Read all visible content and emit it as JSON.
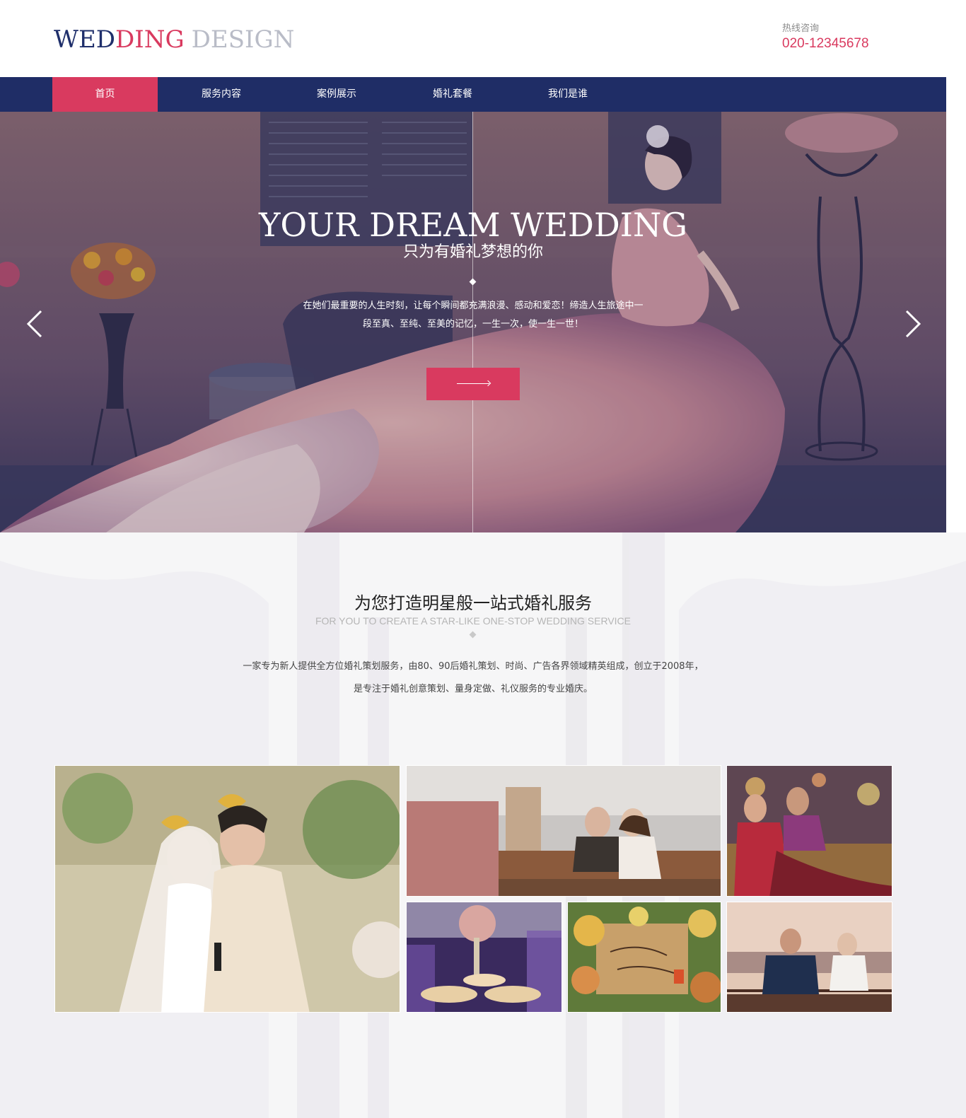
{
  "header": {
    "logo": {
      "part1": "WED",
      "part2": "DING",
      "part3": "DESIGN"
    },
    "hotline_label": "热线咨询",
    "hotline_phone": "020-12345678"
  },
  "nav": {
    "items": [
      {
        "label": "首页",
        "active": true
      },
      {
        "label": "服务内容",
        "active": false
      },
      {
        "label": "案例展示",
        "active": false
      },
      {
        "label": "婚礼套餐",
        "active": false
      },
      {
        "label": "我们是谁",
        "active": false
      }
    ]
  },
  "hero": {
    "title": "YOUR DREAM WEDDING",
    "subtitle": "只为有婚礼梦想的你",
    "desc_line1": "在她们最重要的人生时刻，让每个瞬间都充满浪漫、感动和爱恋！缔造人生旅途中一",
    "desc_line2": "段至真、至纯、至美的记忆，一生一次，使一生一世！",
    "button_icon": "arrow-right-icon",
    "prev_icon": "chevron-left-icon",
    "next_icon": "chevron-right-icon"
  },
  "services": {
    "title": "为您打造明星般一站式婚礼服务",
    "subtitle": "FOR YOU TO CREATE A STAR-LIKE ONE-STOP WEDDING SERVICE",
    "desc_line1": "一家专为新人提供全方位婚礼策划服务，由80、90后婚礼策划、时尚、广告各界领域精英组成，创立于2008年，",
    "desc_line2": "是专注于婚礼创意策划、量身定做、礼仪服务的专业婚庆。"
  },
  "colors": {
    "brand_navy": "#1f2d66",
    "brand_pink": "#d93a5f",
    "logo_gray": "#b9bcc7"
  }
}
